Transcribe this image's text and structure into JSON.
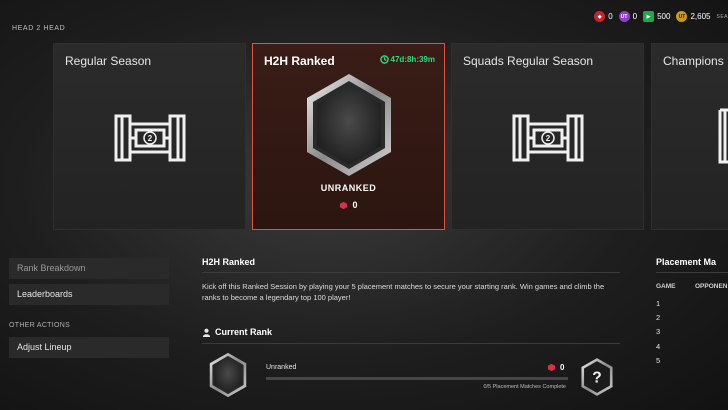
{
  "header": {
    "label": "HEAD 2 HEAD",
    "currencies": [
      {
        "icon": "rp-icon",
        "value": "0",
        "color": "#c2272d"
      },
      {
        "icon": "ut-icon",
        "value": "0",
        "color": "#8d3fc8"
      },
      {
        "icon": "points-icon",
        "value": "500",
        "color": "#1fa84a"
      },
      {
        "icon": "coin-icon",
        "value": "2,605",
        "color": "#c99a1f"
      }
    ],
    "season_tag": "SEA"
  },
  "modes": [
    {
      "title": "Regular Season",
      "active": false
    },
    {
      "title": "H2H Ranked",
      "active": true,
      "timer": "47d:8h:39m",
      "rank": "UNRANKED",
      "points": "0"
    },
    {
      "title": "Squads Regular Season",
      "active": false
    },
    {
      "title": "Champions",
      "active": false
    }
  ],
  "sidebar": {
    "items": [
      {
        "label": "Rank Breakdown",
        "dim": true
      },
      {
        "label": "Leaderboards",
        "dim": false
      }
    ],
    "other_label": "OTHER ACTIONS",
    "other_items": [
      {
        "label": "Adjust Lineup"
      }
    ]
  },
  "detail": {
    "title": "H2H Ranked",
    "description": "Kick off this Ranked Session by playing your 5 placement matches to secure your starting rank. Win games and climb the ranks to become a legendary top 100 player!",
    "current_rank_label": "Current Rank",
    "rank_name": "Unranked",
    "points": "0",
    "placement_progress": 0,
    "placement_text": "0/5 Placement Matches Complete",
    "next_rank_symbol": "?"
  },
  "placement": {
    "title": "Placement Ma",
    "col_game": "GAME",
    "col_opponent": "OPPONEN",
    "games": [
      "1",
      "2",
      "3",
      "4",
      "5"
    ]
  },
  "colors": {
    "accent": "#e1533c",
    "timer": "#2fd67a"
  }
}
